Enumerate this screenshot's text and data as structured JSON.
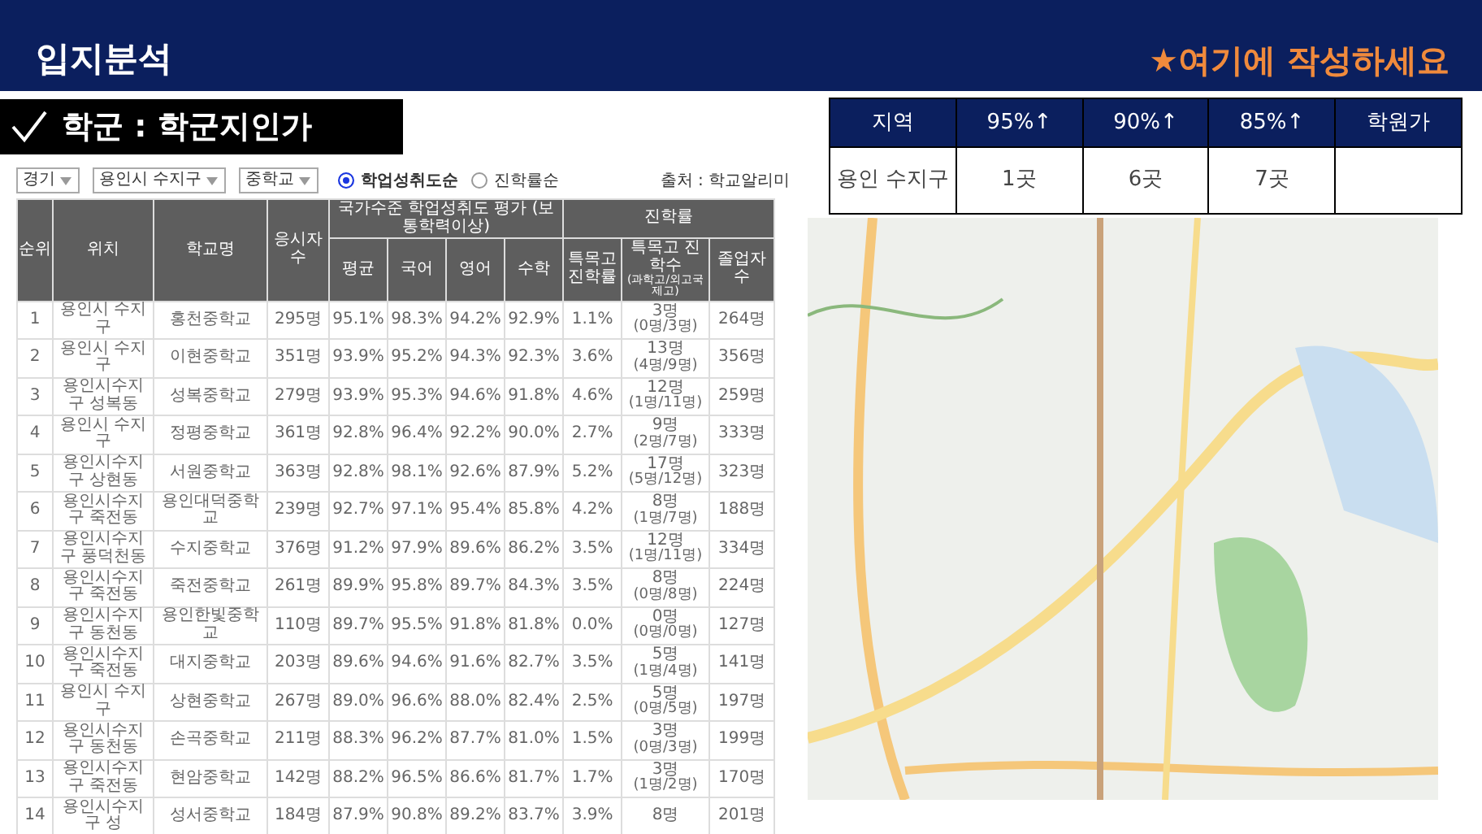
{
  "header": {
    "title": "입지분석",
    "note": "★여기에 작성하세요"
  },
  "section_label": {
    "title": "학군 : 학군지인가"
  },
  "filters": {
    "selects": [
      "경기",
      "용인시 수지구",
      "중학교"
    ],
    "radios": [
      {
        "label": "학업성취도순",
        "selected": true
      },
      {
        "label": "진학률순",
        "selected": false
      }
    ],
    "source": "출처 : 학교알리미"
  },
  "school_table": {
    "columns": [
      {
        "label": "순위"
      },
      {
        "label": "위치"
      },
      {
        "label": "학교명"
      },
      {
        "label": "응시자수"
      },
      {
        "label": "국가수준 학업성취도 평가 (보통학력이상)",
        "colspan": 4,
        "children": [
          {
            "label": "평균"
          },
          {
            "label": "국어"
          },
          {
            "label": "영어"
          },
          {
            "label": "수학"
          }
        ]
      },
      {
        "label": "진학률",
        "colspan": 3,
        "children": [
          {
            "label": "특목고 진학률"
          },
          {
            "label": "특목고 진학수",
            "sublabel": "(과학고/외고국제고)"
          },
          {
            "label": "졸업자수"
          }
        ]
      }
    ],
    "rows": [
      [
        "1",
        "용인시 수지구",
        "홍천중학교",
        "295명",
        "95.1%",
        "98.3%",
        "94.2%",
        "92.9%",
        "1.1%",
        [
          "3명",
          "(0명/3명)"
        ],
        "264명"
      ],
      [
        "2",
        "용인시 수지구",
        "이현중학교",
        "351명",
        "93.9%",
        "95.2%",
        "94.3%",
        "92.3%",
        "3.6%",
        [
          "13명",
          "(4명/9명)"
        ],
        "356명"
      ],
      [
        "3",
        "용인시수지구 성복동",
        "성복중학교",
        "279명",
        "93.9%",
        "95.3%",
        "94.6%",
        "91.8%",
        "4.6%",
        [
          "12명",
          "(1명/11명)"
        ],
        "259명"
      ],
      [
        "4",
        "용인시 수지구",
        "정평중학교",
        "361명",
        "92.8%",
        "96.4%",
        "92.2%",
        "90.0%",
        "2.7%",
        [
          "9명",
          "(2명/7명)"
        ],
        "333명"
      ],
      [
        "5",
        "용인시수지구 상현동",
        "서원중학교",
        "363명",
        "92.8%",
        "98.1%",
        "92.6%",
        "87.9%",
        "5.2%",
        [
          "17명",
          "(5명/12명)"
        ],
        "323명"
      ],
      [
        "6",
        "용인시수지구 죽전동",
        "용인대덕중학교",
        "239명",
        "92.7%",
        "97.1%",
        "95.4%",
        "85.8%",
        "4.2%",
        [
          "8명",
          "(1명/7명)"
        ],
        "188명"
      ],
      [
        "7",
        "용인시수지구 풍덕천동",
        "수지중학교",
        "376명",
        "91.2%",
        "97.9%",
        "89.6%",
        "86.2%",
        "3.5%",
        [
          "12명",
          "(1명/11명)"
        ],
        "334명"
      ],
      [
        "8",
        "용인시수지구 죽전동",
        "죽전중학교",
        "261명",
        "89.9%",
        "95.8%",
        "89.7%",
        "84.3%",
        "3.5%",
        [
          "8명",
          "(0명/8명)"
        ],
        "224명"
      ],
      [
        "9",
        "용인시수지구 동천동",
        "용인한빛중학교",
        "110명",
        "89.7%",
        "95.5%",
        "91.8%",
        "81.8%",
        "0.0%",
        [
          "0명",
          "(0명/0명)"
        ],
        "127명"
      ],
      [
        "10",
        "용인시수지구 죽전동",
        "대지중학교",
        "203명",
        "89.6%",
        "94.6%",
        "91.6%",
        "82.7%",
        "3.5%",
        [
          "5명",
          "(1명/4명)"
        ],
        "141명"
      ],
      [
        "11",
        "용인시 수지구",
        "상현중학교",
        "267명",
        "89.0%",
        "96.6%",
        "88.0%",
        "82.4%",
        "2.5%",
        [
          "5명",
          "(0명/5명)"
        ],
        "197명"
      ],
      [
        "12",
        "용인시수지구 동천동",
        "손곡중학교",
        "211명",
        "88.3%",
        "96.2%",
        "87.7%",
        "81.0%",
        "1.5%",
        [
          "3명",
          "(0명/3명)"
        ],
        "199명"
      ],
      [
        "13",
        "용인시수지구 죽전동",
        "현암중학교",
        "142명",
        "88.2%",
        "96.5%",
        "86.6%",
        "81.7%",
        "1.7%",
        [
          "3명",
          "(1명/2명)"
        ],
        "170명"
      ],
      [
        "14",
        "용인시수지구 성",
        "성서중학교",
        "184명",
        "87.9%",
        "90.8%",
        "89.2%",
        "83.7%",
        "3.9%",
        [
          "8명"
        ],
        "201명"
      ]
    ]
  },
  "summary_table": {
    "columns": [
      "지역",
      "95%↑",
      "90%↑",
      "85%↑",
      "학원가"
    ],
    "rows": [
      [
        "용인 수지구",
        "1곳",
        "6곳",
        "7곳"
      ]
    ]
  }
}
